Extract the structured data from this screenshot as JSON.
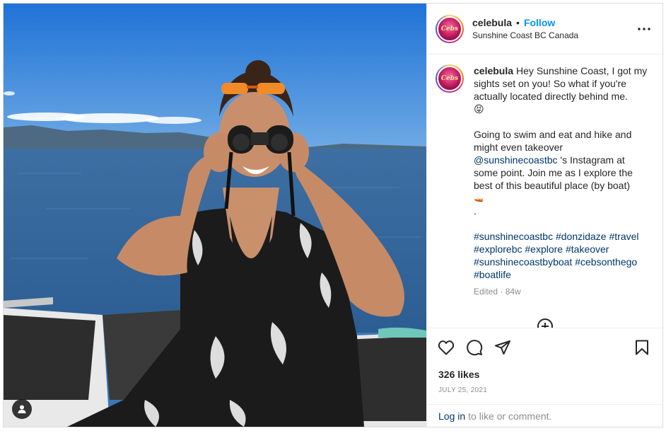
{
  "post": {
    "username": "celebula",
    "separator": "•",
    "follow_label": "Follow",
    "location": "Sunshine Coast BC Canada",
    "avatar_text": "Cebs"
  },
  "caption": {
    "username": "celebula",
    "line1": "Hey Sunshine Coast, I got my",
    "line2": "sights set on you! So what if you're",
    "line3": "actually located directly behind me.",
    "emoji": "😝",
    "p2_line1": "Going to swim and eat and hike and",
    "p2_line2": "might even takeover",
    "p2_mention": "@sunshinecoastbc",
    "p2_line3_rest": " 's Instagram at",
    "p2_line4": "some point. Join me as I explore the",
    "p2_line5": "best of this beautiful place (by boat)",
    "boat_emoji": "🚤",
    "period": ".",
    "hashtags_line1": [
      "#sunshinecoastbc",
      "#donzidaze",
      "#travel"
    ],
    "hashtags_line2": [
      "#explorebc",
      "#explore",
      "#takeover"
    ],
    "hashtags_line3": [
      "#sunshinecoastbyboat",
      "#cebsonthego"
    ],
    "hashtags_line4": [
      "#boatlife"
    ],
    "edited": "Edited · 84w"
  },
  "actions": {
    "icons": [
      "heart-icon",
      "comment-icon",
      "share-icon",
      "bookmark-icon"
    ]
  },
  "likes": "326 likes",
  "date": "JULY 25, 2021",
  "login": {
    "link": "Log in",
    "rest": "to like or comment."
  },
  "colors": {
    "follow": "#0095f6",
    "link": "#00376b",
    "muted": "#8e8e8e",
    "border": "#dbdbdb"
  }
}
